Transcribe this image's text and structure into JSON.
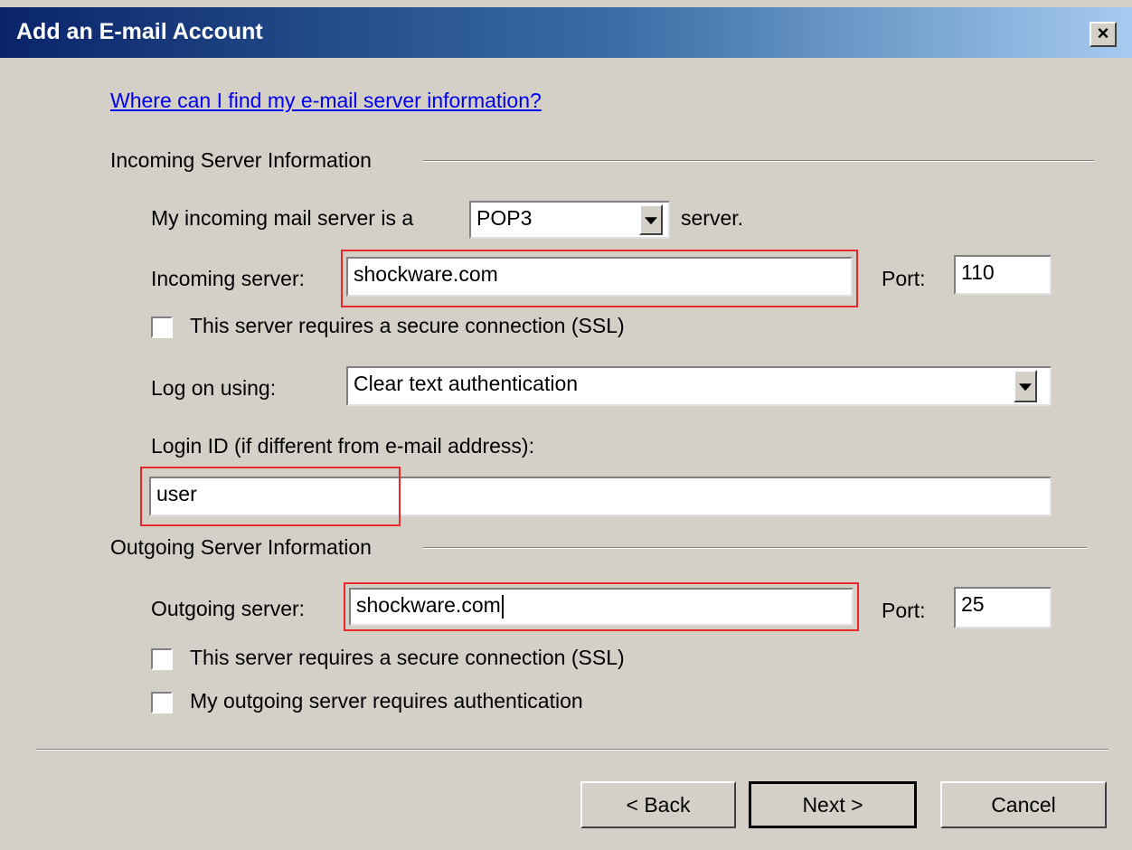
{
  "window": {
    "title": "Add an E-mail Account",
    "close_label": "×"
  },
  "help_link": "Where can I find my e-mail server information?",
  "incoming": {
    "section_label": "Incoming Server Information",
    "server_type_prefix": "My incoming mail server is a",
    "server_type_value": "POP3",
    "server_type_suffix": "server.",
    "server_label": "Incoming server:",
    "server_value": "shockware.com",
    "port_label": "Port:",
    "port_value": "110",
    "ssl_label": "This server requires a secure connection (SSL)",
    "ssl_checked": false,
    "logon_label": "Log on using:",
    "logon_value": "Clear text authentication",
    "login_id_label": "Login ID (if different from e-mail address):",
    "login_id_value": "user"
  },
  "outgoing": {
    "section_label": "Outgoing Server Information",
    "server_label": "Outgoing server:",
    "server_value": "shockware.com",
    "port_label": "Port:",
    "port_value": "25",
    "ssl_label": "This server requires a secure connection (SSL)",
    "ssl_checked": false,
    "auth_label": "My outgoing server requires authentication",
    "auth_checked": false
  },
  "buttons": {
    "back": "< Back",
    "next": "Next >",
    "cancel": "Cancel"
  },
  "colors": {
    "dialog_bg": "#d4d0c8",
    "highlight": "#e8272b",
    "link": "#0000ee"
  }
}
